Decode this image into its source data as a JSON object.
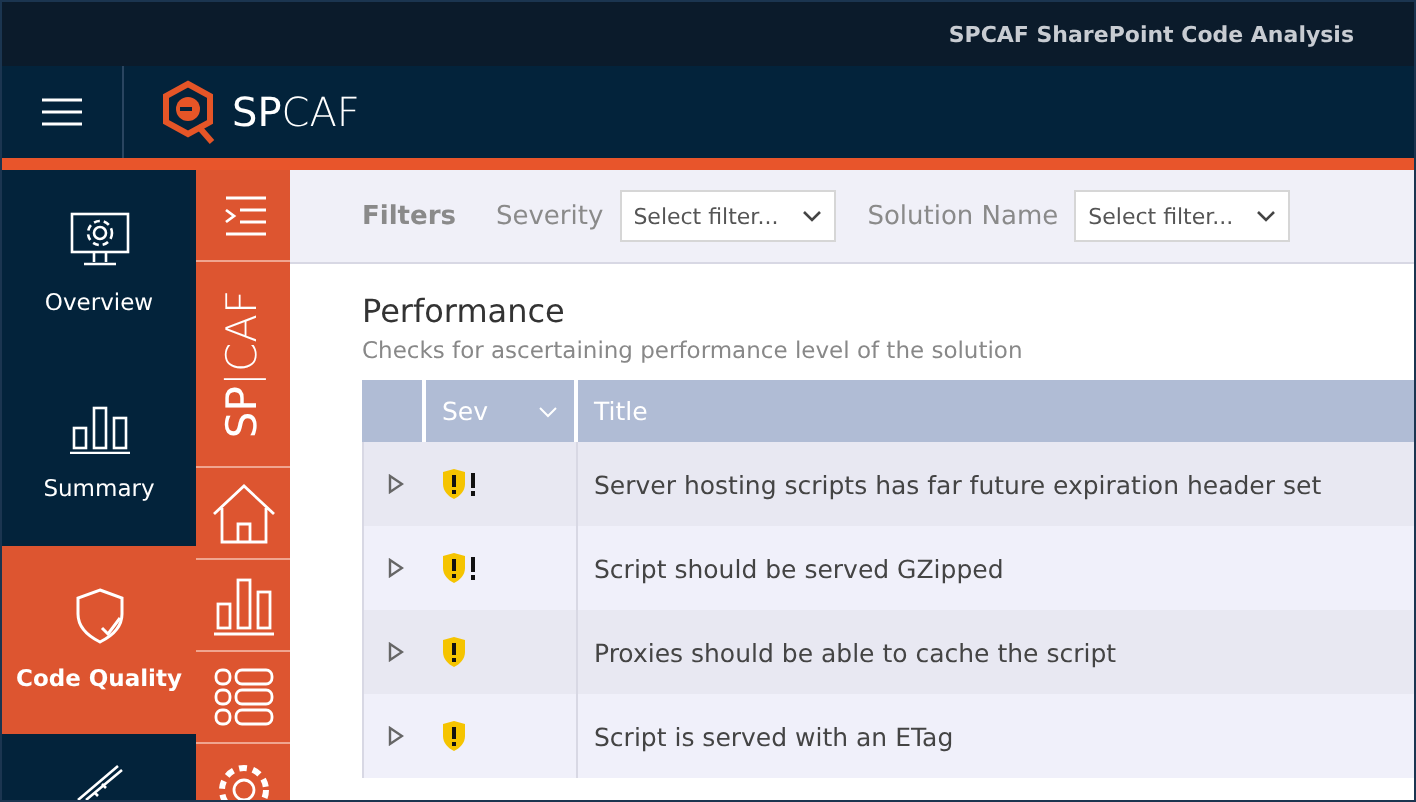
{
  "window": {
    "title": "SPCAF SharePoint Code Analysis"
  },
  "header": {
    "logo": "**SP**CAF"
  },
  "nav": [
    {
      "label": "Overview",
      "selected": false
    },
    {
      "label": "Summary",
      "selected": false
    },
    {
      "label": "Code Quality",
      "selected": true
    },
    {
      "selected": false
    }
  ],
  "side_brand": "**SP**|CAF",
  "filters": {
    "title": "Filters",
    "fields": [
      {
        "label": "Severity",
        "placeholder": "Select filter..."
      },
      {
        "label": "Solution Name",
        "placeholder": "Select filter..."
      }
    ]
  },
  "section": {
    "title": "Performance",
    "subtitle": "Checks for ascertaining performance level of the solution"
  },
  "table": {
    "columns": [
      "Sev",
      "Title"
    ],
    "rows": [
      {
        "critical": true,
        "expanded": false,
        "title": "Server hosting scripts has far future expiration header set"
      },
      {
        "critical": true,
        "expanded": false,
        "title": "Script should be served GZipped"
      },
      {
        "critical": false,
        "expanded": false,
        "title": "Proxies should be able to cache the script"
      },
      {
        "critical": false,
        "expanded": false,
        "title": "Script is served with an ETag"
      }
    ]
  }
}
